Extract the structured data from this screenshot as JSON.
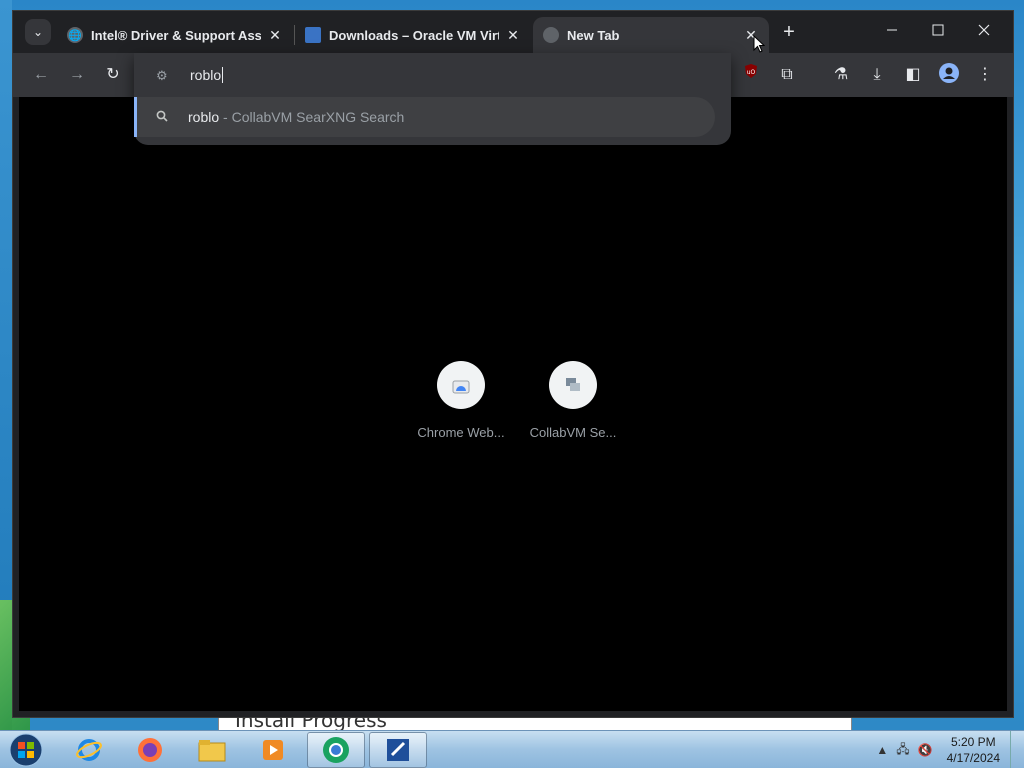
{
  "tabs": [
    {
      "title": "Intel® Driver & Support Assist",
      "close": "✕"
    },
    {
      "title": "Downloads – Oracle VM Virtua",
      "close": "✕"
    },
    {
      "title": "New Tab",
      "close": "✕"
    }
  ],
  "tab_search_icon": "chevron-down-icon",
  "new_tab_label": "+",
  "window_controls": {
    "minimize": "—",
    "maximize": "☐",
    "close": "✕"
  },
  "omnibox": {
    "value": "roblo",
    "suggestion": {
      "query": "roblo",
      "separator": " - ",
      "engine": "CollabVM SearXNG Search"
    }
  },
  "shortcuts": [
    {
      "label": "Chrome Web..."
    },
    {
      "label": "CollabVM Se..."
    }
  ],
  "background_window": {
    "text": "Install Progress"
  },
  "taskbar": {
    "apps": [
      "windows-start-icon",
      "internet-explorer-icon",
      "firefox-icon",
      "file-explorer-icon",
      "media-player-icon",
      "chrome-icon",
      "installer-icon"
    ],
    "time": "5:20 PM",
    "date": "4/17/2024"
  },
  "colors": {
    "accent": "#8ab4f8",
    "toolbar": "#35363a",
    "tabstrip": "#202124"
  }
}
